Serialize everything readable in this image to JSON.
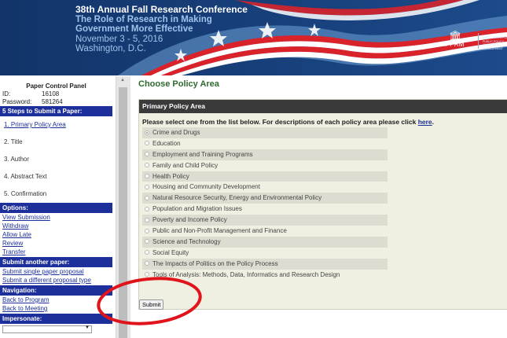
{
  "banner": {
    "title": "38th Annual Fall Research Conference",
    "subtitle_line1": "The Role of Research in Making",
    "subtitle_line2": "Government More Effective",
    "dates": "November 3 - 5, 2016",
    "location": "Washington, D.C.",
    "logo_name": "APPAM",
    "logo_tagline": "ASSOCIATION FOR PUBLIC POLICY ANALYSIS & MANAGEMENT"
  },
  "sidebar": {
    "heading": "Paper Control Panel",
    "id_label": "ID:",
    "id_value": "16108",
    "password_label": "Password:",
    "password_value": "581264",
    "steps_header": "5 Steps to Submit a Paper:",
    "steps": [
      "1. Primary Policy Area",
      "2. Title",
      "3. Author",
      "4. Abstract Text",
      "5. Confirmation"
    ],
    "options_header": "Options:",
    "options": [
      "View Submission",
      "Withdraw",
      "Allow Late",
      "Review",
      "Transfer"
    ],
    "submit_another_header": "Submit another paper:",
    "submit_another": [
      "Submit single paper proposal",
      "Submit a different proposal type"
    ],
    "navigation_header": "Navigation:",
    "navigation": [
      "Back to Program",
      "Back to Meeting"
    ],
    "impersonate_header": "Impersonate:"
  },
  "main": {
    "page_title": "Choose Policy Area",
    "card_header": "Primary Policy Area",
    "instruction": "Please select one from the list below. For descriptions of each policy area please click",
    "instruction_link": "here",
    "selected_index": 0,
    "policy_areas": [
      "Crime and Drugs",
      "Education",
      "Employment and Training Programs",
      "Family and Child Policy",
      "Health Policy",
      "Housing and Community Development",
      "Natural Resource Security, Energy and Environmental Policy",
      "Population and Migration Issues",
      "Poverty and Income Policy",
      "Public and Non-Profit Management and Finance",
      "Science and Technology",
      "Social Equity",
      "The Impacts of Politics on the Policy Process",
      "Tools of Analysis: Methods, Data, Informatics and Research Design"
    ],
    "submit_label": "Submit"
  },
  "colors": {
    "banner_bg": "#163a73",
    "nav_header": "#1d2f9b",
    "title_green": "#2f6a2f",
    "annotation_red": "#e0141b"
  }
}
